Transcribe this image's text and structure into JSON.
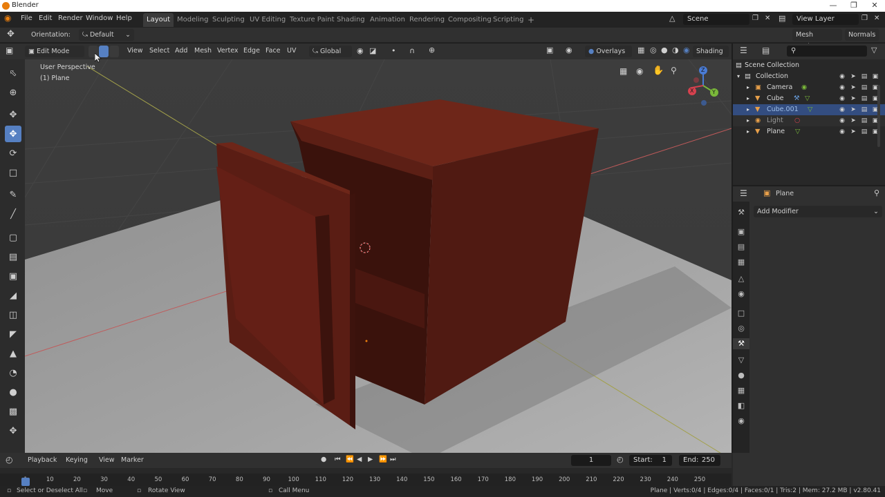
{
  "window": {
    "title": "Blender"
  },
  "menus": [
    "File",
    "Edit",
    "Render",
    "Window",
    "Help"
  ],
  "workspaces": [
    {
      "label": "Layout",
      "active": true
    },
    {
      "label": "Modeling"
    },
    {
      "label": "Sculpting"
    },
    {
      "label": "UV Editing"
    },
    {
      "label": "Texture Paint"
    },
    {
      "label": "Shading"
    },
    {
      "label": "Animation"
    },
    {
      "label": "Rendering"
    },
    {
      "label": "Compositing"
    },
    {
      "label": "Scripting"
    }
  ],
  "add_workspace": "+",
  "scene": {
    "label": "Scene"
  },
  "view_layer": {
    "label": "View Layer"
  },
  "tool_settings": {
    "orientation_label": "Orientation:",
    "orientation_value": "Default",
    "mesh_options": "Mesh Options",
    "normals": "Normals"
  },
  "viewport_header": {
    "mode": "Edit Mode",
    "menus": [
      "View",
      "Select",
      "Add",
      "Mesh",
      "Vertex",
      "Edge",
      "Face",
      "UV"
    ],
    "transform": "Global",
    "overlays": "Overlays",
    "shading": "Shading"
  },
  "viewport": {
    "perspective": "User Perspective",
    "object": "(1) Plane",
    "gizmo": {
      "x": "X",
      "y": "Y",
      "z": "Z"
    }
  },
  "outliner": {
    "root": "Scene Collection",
    "collection": "Collection",
    "items": [
      {
        "name": "Camera"
      },
      {
        "name": "Cube"
      },
      {
        "name": "Cube.001",
        "selected": true
      },
      {
        "name": "Light"
      },
      {
        "name": "Plane"
      }
    ]
  },
  "properties": {
    "object": "Plane",
    "add_modifier": "Add Modifier"
  },
  "timeline": {
    "menus": [
      "Playback",
      "Keying",
      "View",
      "Marker"
    ],
    "current_frame": "1",
    "start_label": "Start:",
    "start": "1",
    "end_label": "End:",
    "end": "250",
    "ticks": [
      "1",
      "10",
      "20",
      "30",
      "40",
      "50",
      "60",
      "70",
      "80",
      "90",
      "100",
      "110",
      "120",
      "130",
      "140",
      "150",
      "160",
      "170",
      "180",
      "190",
      "200",
      "210",
      "220",
      "230",
      "240",
      "250"
    ]
  },
  "status": {
    "select": "Select or Deselect All",
    "move": "Move",
    "rotate": "Rotate View",
    "call_menu": "Call Menu",
    "stats": "Plane | Verts:0/4 | Edges:0/4 | Faces:0/1 | Tris:2 | Mem: 27.2 MB | v2.80.41"
  },
  "colors": {
    "accent": "#5680c2",
    "object_red": "#6b2418",
    "selection": "#334d80",
    "orange": "#e87d0d"
  }
}
